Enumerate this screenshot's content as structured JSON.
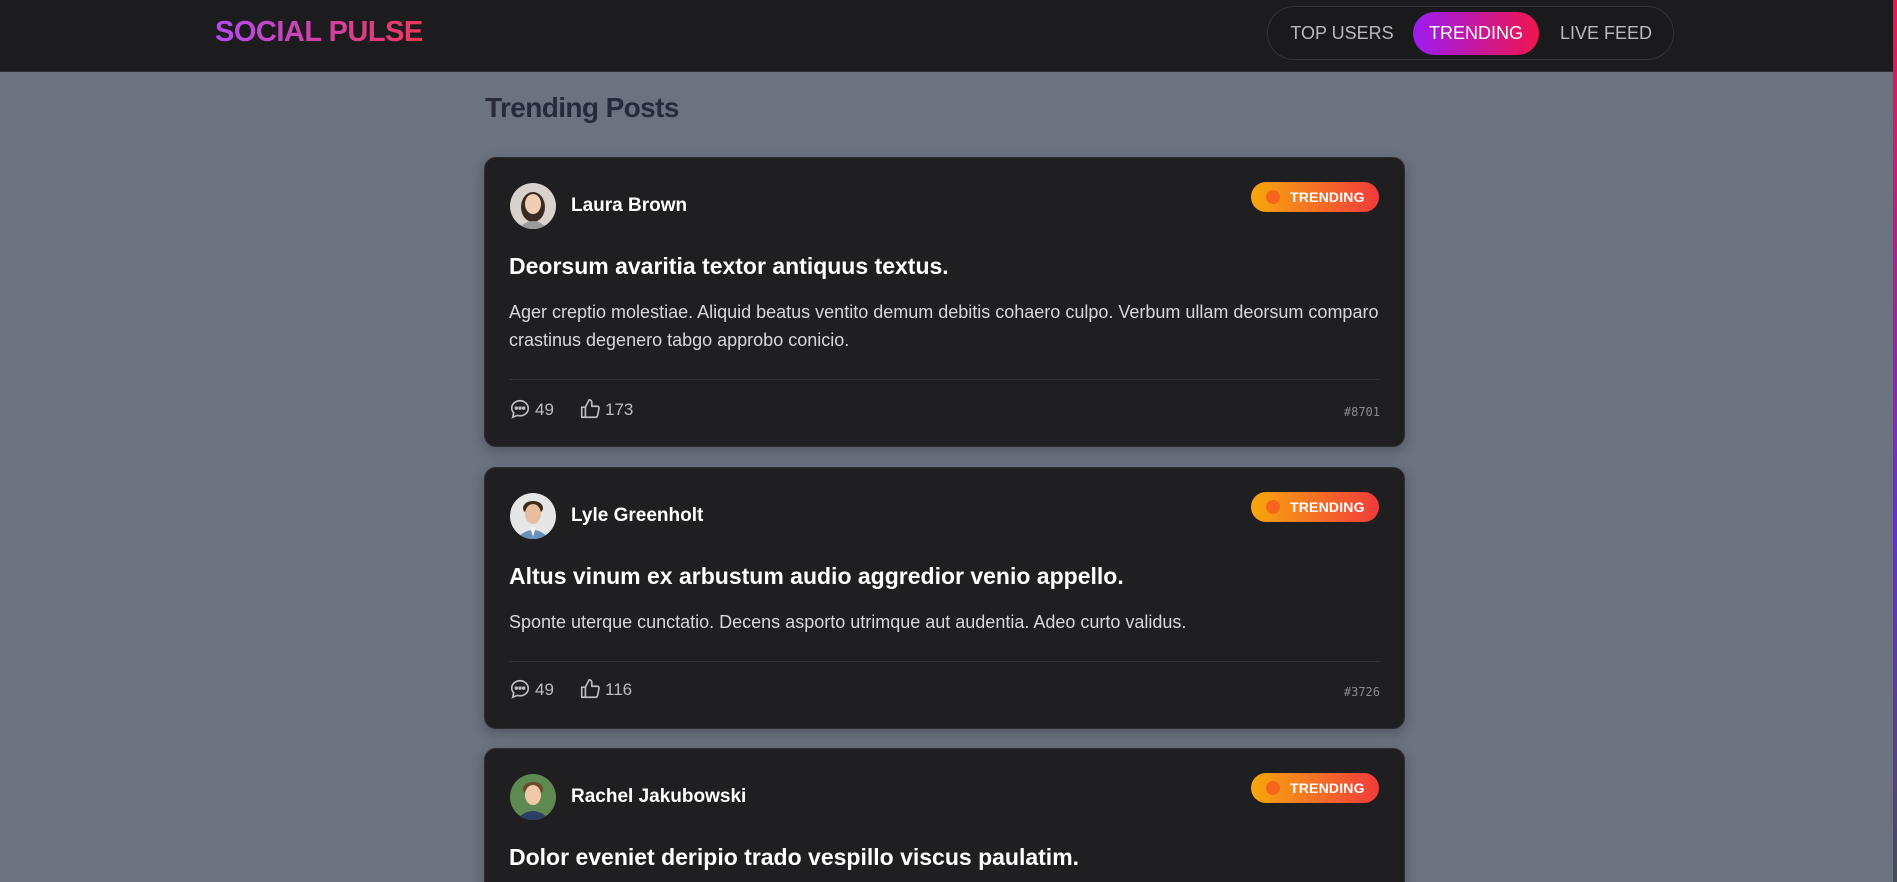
{
  "header": {
    "brand": "SOCIAL PULSE",
    "nav": [
      {
        "label": "TOP USERS",
        "active": false
      },
      {
        "label": "TRENDING",
        "active": true
      },
      {
        "label": "LIVE FEED",
        "active": false
      }
    ]
  },
  "page": {
    "title": "Trending Posts"
  },
  "posts": [
    {
      "author": "Laura Brown",
      "badge": "TRENDING",
      "title": "Deorsum avaritia textor antiquus textus.",
      "body": "Ager creptio molestiae. Aliquid beatus ventito demum debitis cohaero culpo. Verbum ullam deorsum comparo crastinus degenero tabgo approbo conicio.",
      "comments": "49",
      "likes": "173",
      "id": "#8701"
    },
    {
      "author": "Lyle Greenholt",
      "badge": "TRENDING",
      "title": "Altus vinum ex arbustum audio aggredior venio appello.",
      "body": "Sponte uterque cunctatio. Decens asporto utrimque aut audentia. Adeo curto validus.",
      "comments": "49",
      "likes": "116",
      "id": "#3726"
    },
    {
      "author": "Rachel Jakubowski",
      "badge": "TRENDING",
      "title": "Dolor eveniet deripio trado vespillo viscus paulatim."
    }
  ],
  "icons": {
    "comment": "comment-icon",
    "like": "thumbs-up-icon",
    "badge_dot": "dot-icon"
  },
  "colors": {
    "background": "#6b7280",
    "card": "#1f1f21",
    "topbar": "#1c1c1e",
    "accent_gradient_start": "#9b1cf1",
    "accent_gradient_end": "#f0154b",
    "badge_start": "#f7a70c",
    "badge_end": "#f23b3b"
  }
}
